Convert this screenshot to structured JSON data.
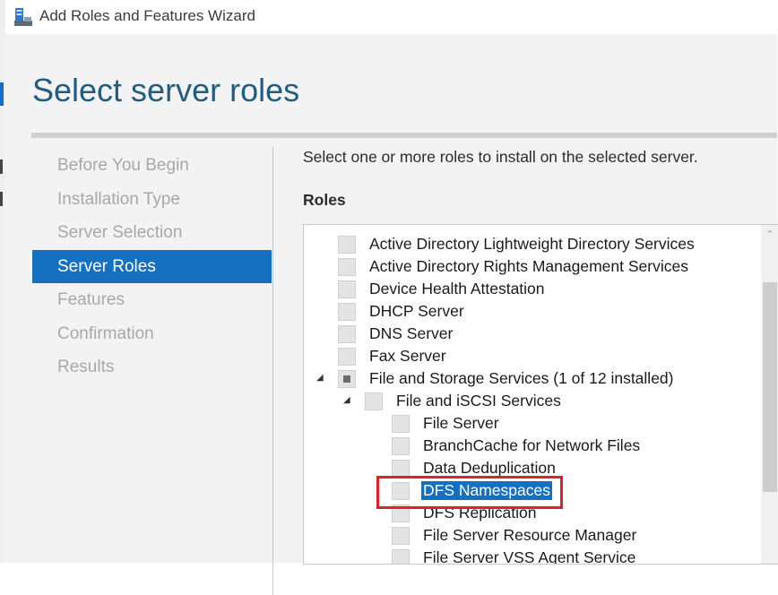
{
  "window": {
    "title": "Add Roles and Features Wizard",
    "icon": "server-manager-icon"
  },
  "page": {
    "title": "Select server roles",
    "intro": "Select one or more roles to install on the selected server.",
    "roles_heading": "Roles"
  },
  "nav": {
    "items": [
      {
        "label": "Before You Begin",
        "active": false
      },
      {
        "label": "Installation Type",
        "active": false
      },
      {
        "label": "Server Selection",
        "active": false
      },
      {
        "label": "Server Roles",
        "active": true
      },
      {
        "label": "Features",
        "active": false
      },
      {
        "label": "Confirmation",
        "active": false
      },
      {
        "label": "Results",
        "active": false
      }
    ]
  },
  "roles": [
    {
      "label": "Active Directory Lightweight Directory Services",
      "state": "unchecked"
    },
    {
      "label": "Active Directory Rights Management Services",
      "state": "unchecked"
    },
    {
      "label": "Device Health Attestation",
      "state": "unchecked"
    },
    {
      "label": "DHCP Server",
      "state": "unchecked"
    },
    {
      "label": "DNS Server",
      "state": "unchecked"
    },
    {
      "label": "Fax Server",
      "state": "unchecked"
    },
    {
      "label": "File and Storage Services (1 of 12 installed)",
      "state": "partial",
      "expanded": true
    },
    {
      "label": "File and iSCSI Services",
      "state": "unchecked",
      "expanded": true
    },
    {
      "label": "File Server",
      "state": "unchecked"
    },
    {
      "label": "BranchCache for Network Files",
      "state": "unchecked"
    },
    {
      "label": "Data Deduplication",
      "state": "unchecked"
    },
    {
      "label": "DFS Namespaces",
      "state": "unchecked",
      "selected": true
    },
    {
      "label": "DFS Replication",
      "state": "unchecked"
    },
    {
      "label": "File Server Resource Manager",
      "state": "unchecked"
    },
    {
      "label": "File Server VSS Agent Service",
      "state": "unchecked"
    }
  ],
  "colors": {
    "accent": "#1570c2",
    "title": "#1e5d80",
    "highlight_border": "#e0202a"
  }
}
